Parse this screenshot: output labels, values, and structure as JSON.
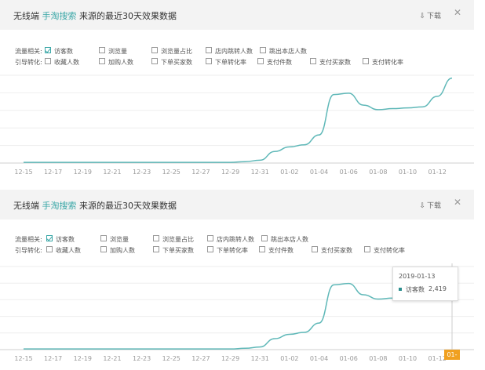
{
  "panels": [
    {
      "title_prefix": "无线端",
      "title_source": "手淘搜索",
      "title_suffix": "来源的最近30天效果数据",
      "download_label": "下载",
      "download_icon": "download-icon",
      "close_icon": "close-icon",
      "filters": {
        "traffic_label": "流量相关:",
        "traffic": [
          {
            "label": "访客数",
            "checked": true
          },
          {
            "label": "浏览量",
            "checked": false
          },
          {
            "label": "浏览量占比",
            "checked": false
          },
          {
            "label": "店内跳转人数",
            "checked": false
          },
          {
            "label": "跳出本店人数",
            "checked": false
          }
        ],
        "conversion_label": "引导转化:",
        "conversion": [
          {
            "label": "收藏人数",
            "checked": false
          },
          {
            "label": "加购人数",
            "checked": false
          },
          {
            "label": "下单买家数",
            "checked": false
          },
          {
            "label": "下单转化率",
            "checked": false
          },
          {
            "label": "支付件数",
            "checked": false
          },
          {
            "label": "支付买家数",
            "checked": false
          },
          {
            "label": "支付转化率",
            "checked": false
          }
        ]
      }
    },
    {
      "title_prefix": "无线端",
      "title_source": "手淘搜索",
      "title_suffix": "来源的最近30天效果数据",
      "download_label": "下载",
      "download_icon": "download-icon",
      "close_icon": "close-icon",
      "filters": {
        "traffic_label": "流量相关:",
        "traffic": [
          {
            "label": "访客数",
            "checked": true
          },
          {
            "label": "浏览量",
            "checked": false
          },
          {
            "label": "浏览量占比",
            "checked": false
          },
          {
            "label": "店内跳转人数",
            "checked": false
          },
          {
            "label": "跳出本店人数",
            "checked": false
          }
        ],
        "conversion_label": "引导转化:",
        "conversion": [
          {
            "label": "收藏人数",
            "checked": false
          },
          {
            "label": "加购人数",
            "checked": false
          },
          {
            "label": "下单买家数",
            "checked": false
          },
          {
            "label": "下单转化率",
            "checked": false
          },
          {
            "label": "支付件数",
            "checked": false
          },
          {
            "label": "支付买家数",
            "checked": false
          },
          {
            "label": "支付转化率",
            "checked": false
          }
        ]
      },
      "tooltip": {
        "date": "2019-01-13",
        "series": "访客数",
        "value": "2,419"
      },
      "highlight_tick": "01-13"
    }
  ],
  "colors": {
    "accent": "#3aa7a7",
    "line": "#5fb8b8",
    "highlight": "#f0a020"
  },
  "chart_data": [
    {
      "type": "line",
      "categories": [
        "12-15",
        "12-16",
        "12-17",
        "12-18",
        "12-19",
        "12-20",
        "12-21",
        "12-22",
        "12-23",
        "12-24",
        "12-25",
        "12-26",
        "12-27",
        "12-28",
        "12-29",
        "12-30",
        "12-31",
        "01-01",
        "01-02",
        "01-03",
        "01-04",
        "01-05",
        "01-06",
        "01-07",
        "01-08",
        "01-09",
        "01-10",
        "01-11",
        "01-12",
        "01-13"
      ],
      "tick_labels": [
        "12-15",
        "12-17",
        "12-19",
        "12-21",
        "12-23",
        "12-25",
        "12-27",
        "12-29",
        "12-31",
        "01-02",
        "01-04",
        "01-06",
        "01-08",
        "01-10",
        "01-12"
      ],
      "series": [
        {
          "values": [
            20,
            20,
            20,
            20,
            20,
            20,
            20,
            20,
            20,
            20,
            20,
            20,
            20,
            20,
            20,
            40,
            80,
            330,
            460,
            520,
            800,
            1950,
            1990,
            1650,
            1520,
            1550,
            1570,
            1600,
            1900,
            2419
          ]
        }
      ],
      "ylim": [
        0,
        2500
      ],
      "grid": true
    },
    {
      "type": "line",
      "categories": [
        "12-15",
        "12-16",
        "12-17",
        "12-18",
        "12-19",
        "12-20",
        "12-21",
        "12-22",
        "12-23",
        "12-24",
        "12-25",
        "12-26",
        "12-27",
        "12-28",
        "12-29",
        "12-30",
        "12-31",
        "01-01",
        "01-02",
        "01-03",
        "01-04",
        "01-05",
        "01-06",
        "01-07",
        "01-08",
        "01-09",
        "01-10",
        "01-11",
        "01-12",
        "01-13"
      ],
      "tick_labels": [
        "12-15",
        "12-17",
        "12-19",
        "12-21",
        "12-23",
        "12-25",
        "12-27",
        "12-29",
        "12-31",
        "01-02",
        "01-04",
        "01-06",
        "01-08",
        "01-10",
        "01-12",
        "01-13"
      ],
      "series": [
        {
          "values": [
            20,
            20,
            20,
            20,
            20,
            20,
            20,
            20,
            20,
            20,
            20,
            20,
            20,
            20,
            20,
            40,
            80,
            330,
            460,
            520,
            800,
            1950,
            1990,
            1650,
            1520,
            1550,
            1570,
            1600,
            1900,
            2419
          ]
        }
      ],
      "ylim": [
        0,
        2500
      ],
      "grid": true
    }
  ]
}
